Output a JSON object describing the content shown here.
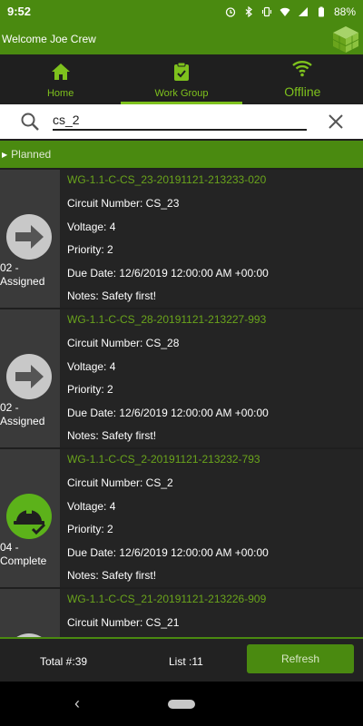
{
  "status_bar": {
    "time": "9:52",
    "battery": "88%"
  },
  "app_bar": {
    "title": "Welcome  Joe Crew"
  },
  "tabs": [
    {
      "label": "Home",
      "icon": "home-icon"
    },
    {
      "label": "Work Group",
      "icon": "clipboard-check-icon"
    },
    {
      "label": "Offline",
      "icon": "wifi-icon"
    }
  ],
  "search": {
    "value": "cs_2",
    "placeholder": ""
  },
  "section": {
    "label": "Planned"
  },
  "items": [
    {
      "status": "02 - Assigned",
      "status_icon": "arrow-right-icon",
      "id": "WG-1.1-C-CS_23-20191121-213233-020",
      "circuit": "Circuit Number: CS_23",
      "voltage": "Voltage: 4",
      "priority": "Priority: 2",
      "due": "Due Date: 12/6/2019 12:00:00 AM +00:00",
      "notes": "Notes: Safety first!"
    },
    {
      "status": "02 - Assigned",
      "status_icon": "arrow-right-icon",
      "id": "WG-1.1-C-CS_28-20191121-213227-993",
      "circuit": "Circuit Number: CS_28",
      "voltage": "Voltage: 4",
      "priority": "Priority: 2",
      "due": "Due Date: 12/6/2019 12:00:00 AM +00:00",
      "notes": "Notes: Safety first!"
    },
    {
      "status": "04 - Complete",
      "status_icon": "hardhat-check-icon",
      "id": "WG-1.1-C-CS_2-20191121-213232-793",
      "circuit": "Circuit Number: CS_2",
      "voltage": "Voltage: 4",
      "priority": "Priority: 2",
      "due": "Due Date: 12/6/2019 12:00:00 AM +00:00",
      "notes": "Notes: Safety first!"
    },
    {
      "status": "",
      "status_icon": "arrow-right-icon",
      "id": "WG-1.1-C-CS_21-20191121-213226-909",
      "circuit": "Circuit Number: CS_21",
      "voltage": "",
      "priority": "",
      "due": "",
      "notes": ""
    }
  ],
  "footer": {
    "total": "Total #:39",
    "list": "List :11",
    "refresh_label": "Refresh"
  },
  "colors": {
    "accent": "#4a8a10",
    "accent_light": "#7ec11d",
    "id_text": "#6aa41c"
  }
}
